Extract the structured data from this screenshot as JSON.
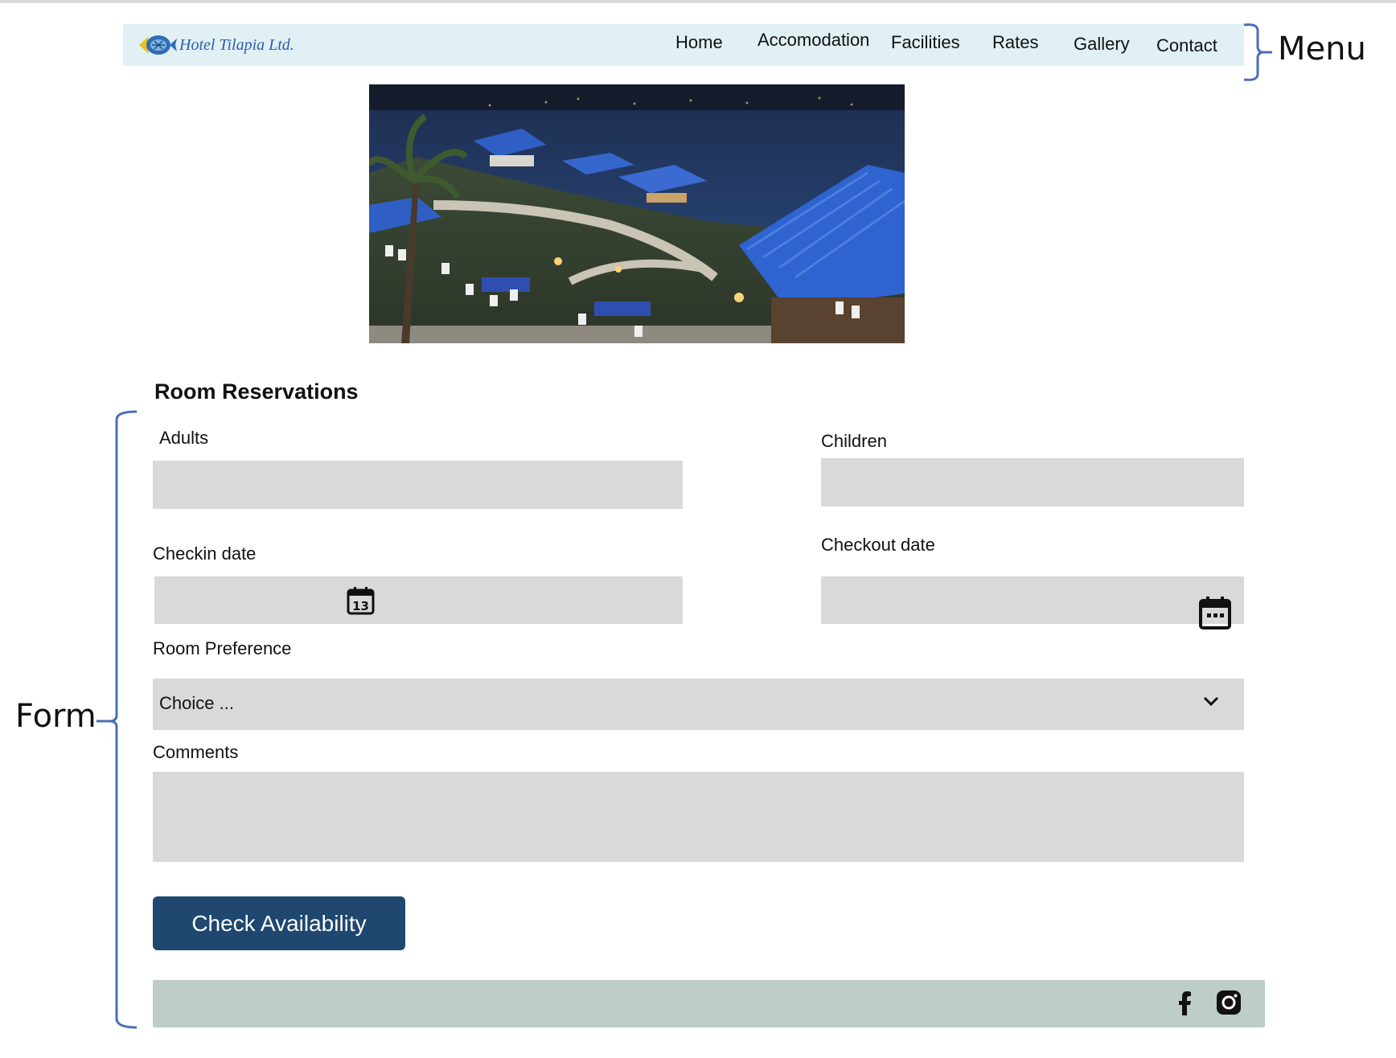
{
  "brand": {
    "name": "Hotel Tilapia Ltd."
  },
  "nav": {
    "items": [
      {
        "label": "Home"
      },
      {
        "label": "Accomodation"
      },
      {
        "label": "Facilities"
      },
      {
        "label": "Rates"
      },
      {
        "label": "Gallery"
      },
      {
        "label": "Contact"
      }
    ]
  },
  "annotations": {
    "menu": "Menu",
    "form": "Form"
  },
  "form": {
    "title": "Room Reservations",
    "adults_label": "Adults",
    "adults_value": "",
    "children_label": "Children",
    "children_value": "",
    "checkin_label": "Checkin date",
    "checkin_value": "",
    "checkout_label": "Checkout date",
    "checkout_value": "",
    "calendar_day": "13",
    "room_pref_label": "Room Preference",
    "room_pref_value": "Choice ...",
    "comments_label": "Comments",
    "comments_value": "",
    "submit_label": "Check Availability"
  },
  "footer": {
    "icons": [
      "facebook-icon",
      "instagram-icon"
    ]
  },
  "colors": {
    "nav_bg": "#e1f0f5",
    "field_bg": "#d9d9d9",
    "button_bg": "#1f4770",
    "footer_bg": "#bccec5",
    "annotation_bracket": "#4a6fb5"
  }
}
